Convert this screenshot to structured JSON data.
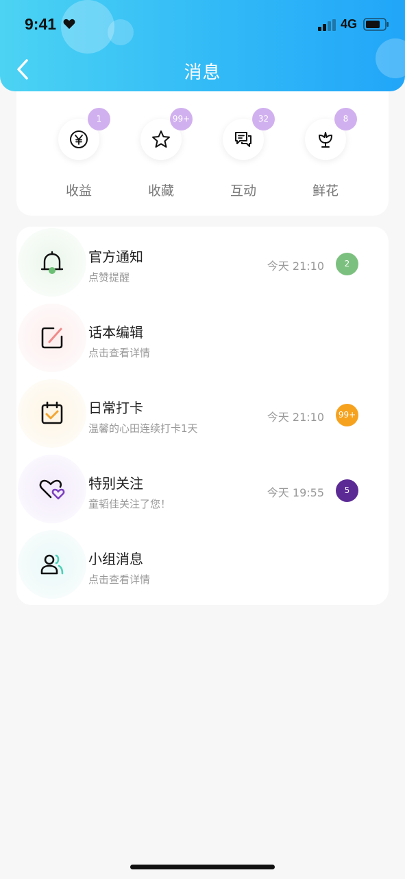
{
  "status_bar": {
    "time": "9:41",
    "network": "4G"
  },
  "header": {
    "title": "消息"
  },
  "categories": [
    {
      "label": "收益",
      "badge": "1",
      "icon": "yen-icon"
    },
    {
      "label": "收藏",
      "badge": "99+",
      "icon": "star-icon"
    },
    {
      "label": "互动",
      "badge": "32",
      "icon": "chat-icon"
    },
    {
      "label": "鲜花",
      "badge": "8",
      "icon": "flower-icon"
    }
  ],
  "messages": [
    {
      "title": "官方通知",
      "subtitle": "点赞提醒",
      "time": "今天 21:10",
      "count": "2",
      "icon": "bell-icon",
      "count_color": "#7cc07f",
      "icon_bg": "#eef8ef"
    },
    {
      "title": "话本编辑",
      "subtitle": "点击查看详情",
      "time": "",
      "count": "",
      "icon": "edit-icon",
      "icon_bg": "#fdf0f1"
    },
    {
      "title": "日常打卡",
      "subtitle": "温馨的心田连续打卡1天",
      "time": "今天 21:10",
      "count": "99+",
      "icon": "calendar-check-icon",
      "count_color": "#f6a21e",
      "icon_bg": "#fdf7ec"
    },
    {
      "title": "特别关注",
      "subtitle": "童韬佳关注了您！",
      "time": "今天 19:55",
      "count": "5",
      "icon": "hearts-icon",
      "count_color": "#5b2a95",
      "icon_bg": "#f5f0fb"
    },
    {
      "title": "小组消息",
      "subtitle": "点击查看详情",
      "time": "",
      "count": "",
      "icon": "group-icon",
      "icon_bg": "#eefafa"
    }
  ],
  "colors": {
    "header_start": "#4cd3f3",
    "header_end": "#21a6f8",
    "badge": "#d1b0ef"
  }
}
